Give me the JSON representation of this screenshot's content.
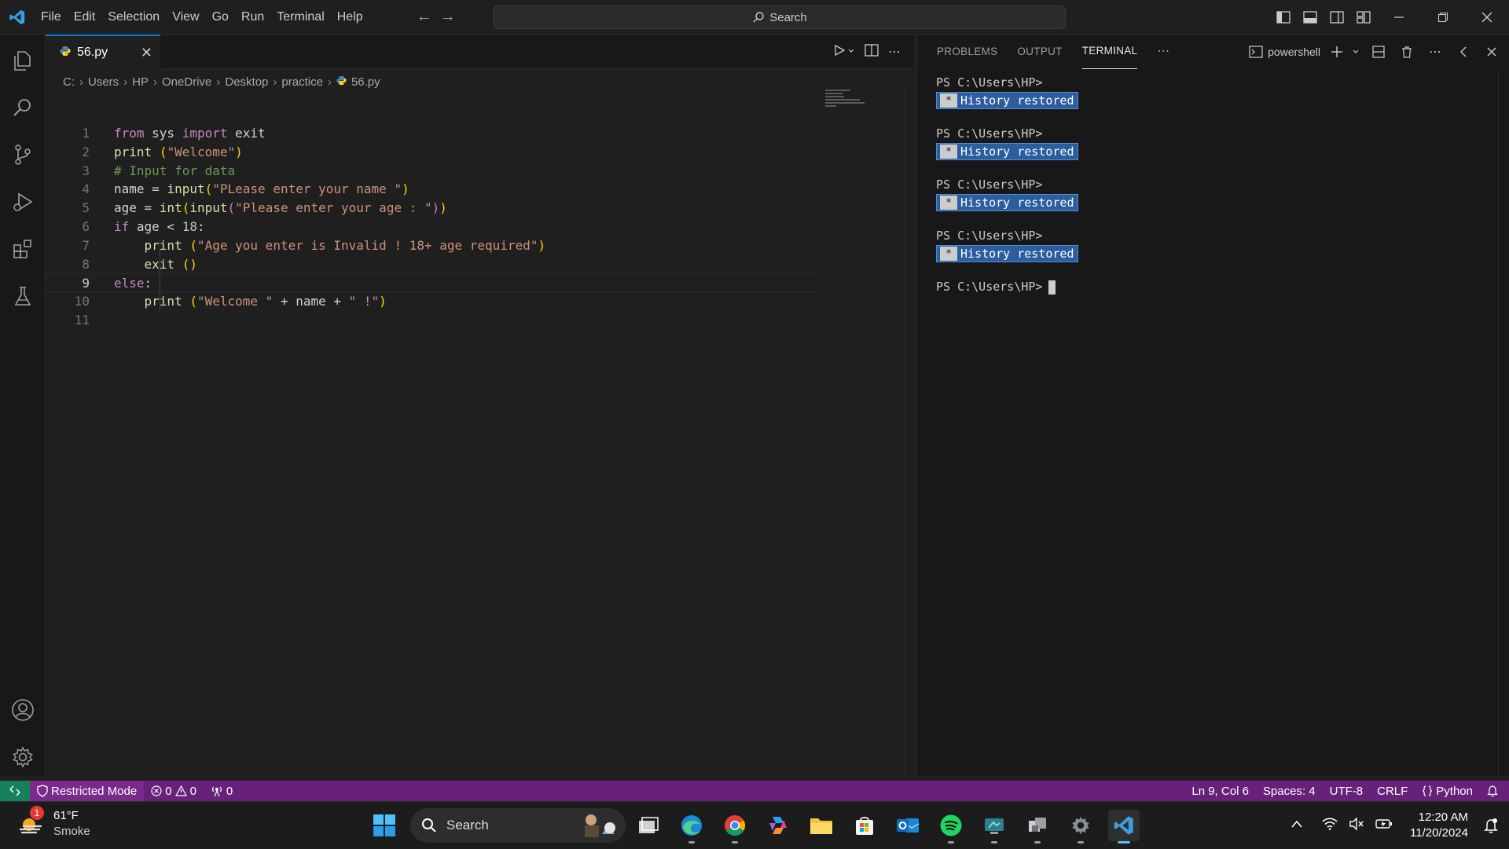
{
  "titlebar": {
    "menu": [
      "File",
      "Edit",
      "Selection",
      "View",
      "Go",
      "Run",
      "Terminal",
      "Help"
    ],
    "command_center": "Search"
  },
  "editor": {
    "tab_label": "56.py",
    "breadcrumb": [
      "C:",
      "Users",
      "HP",
      "OneDrive",
      "Desktop",
      "practice",
      "56.py"
    ],
    "line_numbers": [
      "1",
      "2",
      "3",
      "4",
      "5",
      "6",
      "7",
      "8",
      "9",
      "10",
      "11"
    ],
    "active_line": "9"
  },
  "panel": {
    "tabs": [
      "PROBLEMS",
      "OUTPUT",
      "TERMINAL"
    ],
    "active_tab": "TERMINAL",
    "shell_name": "powershell",
    "prompt": "PS C:\\Users\\HP>",
    "history_label": "History restored",
    "history_star": "*"
  },
  "statusbar": {
    "restricted_mode": "Restricted Mode",
    "errors": "0",
    "warnings": "0",
    "ports": "0",
    "cursor_position": "Ln 9, Col 6",
    "indentation": "Spaces: 4",
    "encoding": "UTF-8",
    "eol": "CRLF",
    "language": "Python"
  },
  "taskbar": {
    "weather_temp": "61°F",
    "weather_condition": "Smoke",
    "weather_badge": "1",
    "search_label": "Search",
    "time": "12:20 AM",
    "date": "11/20/2024"
  },
  "colors": {
    "accent": "#0078d4",
    "statusbar_bg": "#68217a",
    "remote_bg": "#16825d",
    "history_highlight": "#2c5d9e"
  }
}
